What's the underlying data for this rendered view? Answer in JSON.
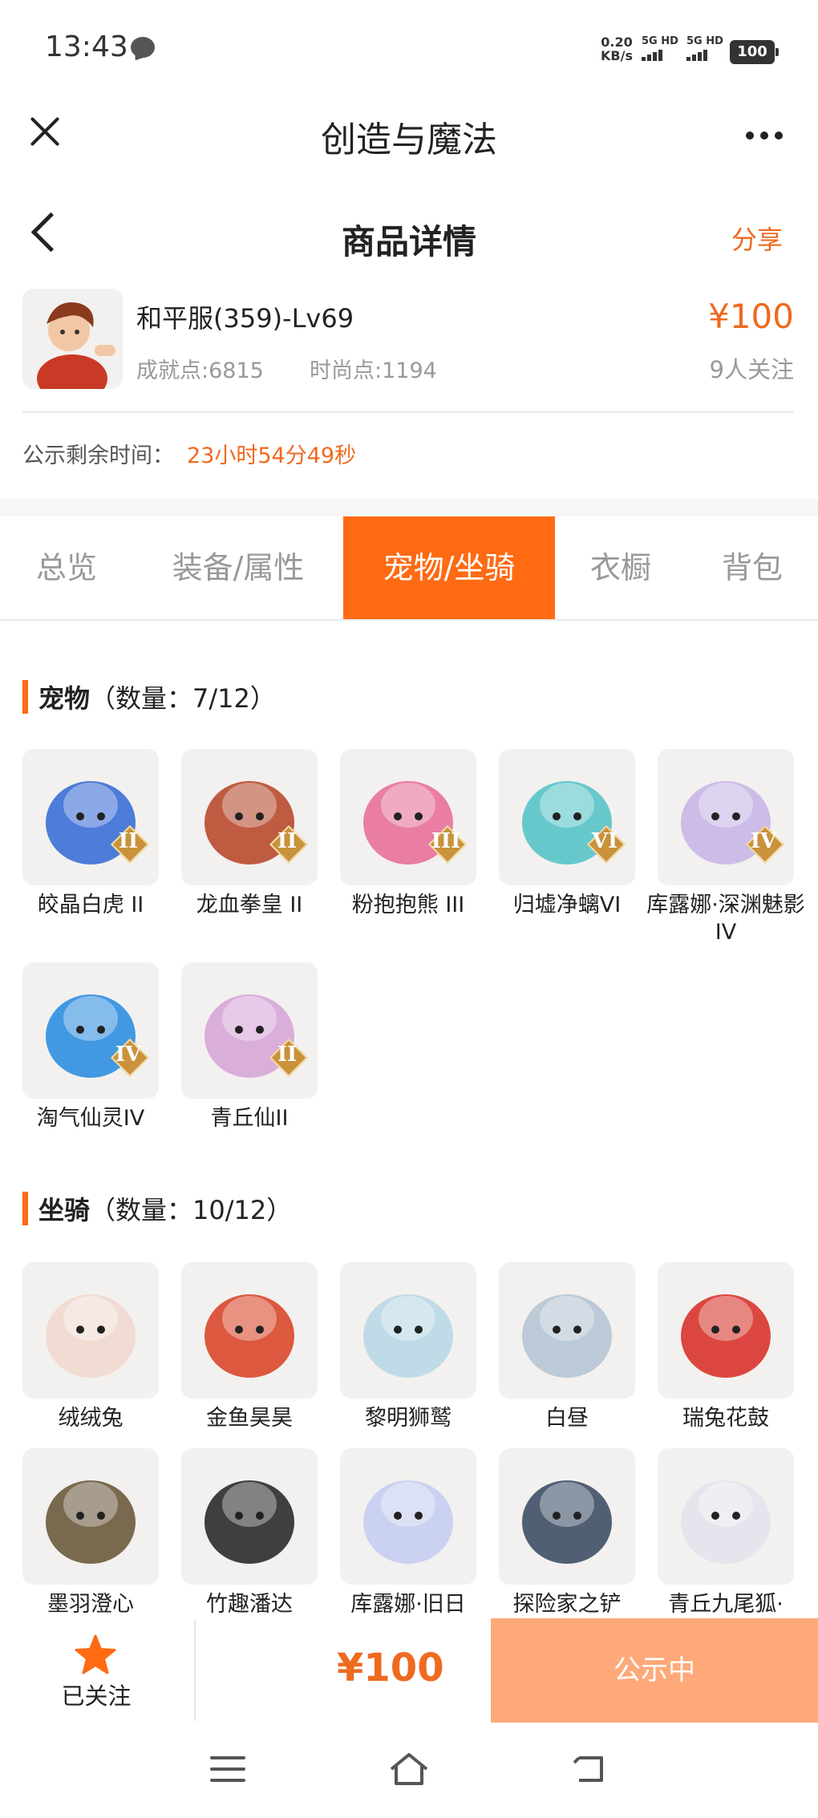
{
  "status_bar": {
    "time": "13:43",
    "speed_value": "0.20",
    "speed_unit": "KB/s",
    "signal_label_1": "5G HD",
    "signal_label_2": "5G HD",
    "battery": "100"
  },
  "app_bar": {
    "title": "创造与魔法",
    "close_icon": "close-icon",
    "more_icon": "more-icon"
  },
  "header": {
    "title": "商品详情",
    "share_label": "分享"
  },
  "product": {
    "server_level": "和平服(359)-Lv69",
    "achievement": "成就点:6815",
    "fashion": "时尚点:1194",
    "price": "¥100",
    "followers": "9人关注",
    "notice_label": "公示剩余时间：",
    "notice_time": "23小时54分49秒"
  },
  "tabs": [
    {
      "label": "总览"
    },
    {
      "label": "装备/属性"
    },
    {
      "label": "宠物/坐骑",
      "active": true
    },
    {
      "label": "衣橱"
    },
    {
      "label": "背包"
    }
  ],
  "pets": {
    "title": "宠物",
    "count": "（数量：7/12）",
    "items": [
      {
        "name": "皎晶白虎 II",
        "badge": "II",
        "color": "#3b6fd6"
      },
      {
        "name": "龙血拳皇 II",
        "badge": "II",
        "color": "#b84a2e"
      },
      {
        "name": "粉抱抱熊 III",
        "badge": "III",
        "color": "#e8709a"
      },
      {
        "name": "归墟净螭VI",
        "badge": "VI",
        "color": "#58c3c8"
      },
      {
        "name": "库露娜·深渊魅影IV",
        "badge": "IV",
        "color": "#c9b6e6"
      },
      {
        "name": "淘气仙灵IV",
        "badge": "IV",
        "color": "#2f8fe0"
      },
      {
        "name": "青丘仙II",
        "badge": "II",
        "color": "#d7a6d8"
      }
    ]
  },
  "mounts": {
    "title": "坐骑",
    "count": "（数量：10/12）",
    "items": [
      {
        "name": "绒绒兔",
        "color": "#f1d9cf"
      },
      {
        "name": "金鱼昊昊",
        "color": "#d9472b"
      },
      {
        "name": "黎明狮鹫",
        "color": "#b9d8e6"
      },
      {
        "name": "白昼",
        "color": "#b6c5d4"
      },
      {
        "name": "瑞兔花鼓",
        "color": "#d8342c"
      },
      {
        "name": "墨羽澄心",
        "color": "#6b5a3d"
      },
      {
        "name": "竹趣潘达",
        "color": "#2b2b2b"
      },
      {
        "name": "库露娜·旧日",
        "color": "#c7cdf0"
      },
      {
        "name": "探险家之铲",
        "color": "#3f4f66"
      },
      {
        "name": "青丘九尾狐·",
        "color": "#e3e3ec"
      }
    ]
  },
  "bottom": {
    "followed_label": "已关注",
    "price": "¥100",
    "status_button": "公示中",
    "accent": "#ff6a13"
  }
}
